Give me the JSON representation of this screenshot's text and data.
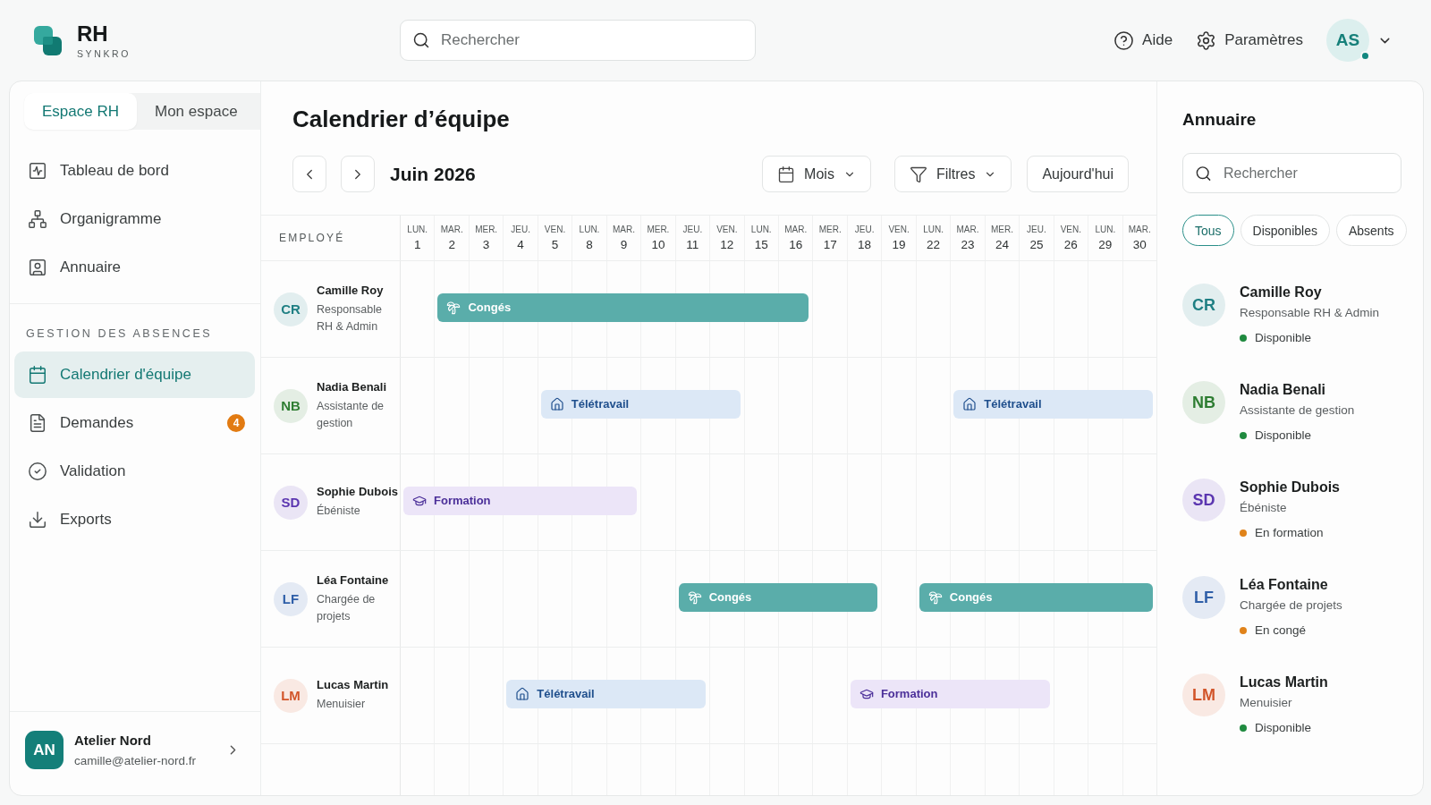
{
  "header": {
    "logo": {
      "title": "RH",
      "subtitle": "SYNKRO"
    },
    "search": {
      "placeholder": "Rechercher"
    },
    "links": [
      {
        "kind": "help",
        "label": "Aide"
      },
      {
        "kind": "settings",
        "label": "Paramètres"
      }
    ],
    "user": {
      "initials": "AS",
      "online": true
    }
  },
  "sidebar": {
    "tabs": [
      {
        "label": "Espace RH",
        "selected": true
      },
      {
        "label": "Mon espace",
        "selected": false
      }
    ],
    "items": [
      {
        "kind": "dashboard",
        "label": "Tableau de bord",
        "selected": false
      },
      {
        "kind": "org",
        "label": "Organigramme",
        "selected": false
      },
      {
        "kind": "directory",
        "label": "Annuaire",
        "selected": false
      }
    ],
    "section": {
      "title": "GESTION DES ABSENCES",
      "items": [
        {
          "kind": "calendar",
          "label": "Calendrier d'équipe",
          "selected": true
        },
        {
          "kind": "requests",
          "label": "Demandes",
          "selected": false,
          "badge": "4"
        },
        {
          "kind": "validation",
          "label": "Validation",
          "selected": false
        },
        {
          "kind": "exports",
          "label": "Exports",
          "selected": false
        }
      ]
    },
    "account": {
      "initials": "AN",
      "name": "Atelier Nord",
      "email": "camille@atelier-nord.fr"
    }
  },
  "calendar": {
    "title": "Calendrier d’équipe",
    "period": "Juin 2026",
    "view_button": {
      "label": "Mois"
    },
    "filter_button": {
      "label": "Filtres"
    },
    "today_button": {
      "label": "Aujourd'hui"
    },
    "employee_column": "EMPLOYÉ",
    "days": [
      {
        "weekday": "LUN.",
        "number": "1"
      },
      {
        "weekday": "MAR.",
        "number": "2"
      },
      {
        "weekday": "MER.",
        "number": "3"
      },
      {
        "weekday": "JEU.",
        "number": "4"
      },
      {
        "weekday": "VEN.",
        "number": "5"
      },
      {
        "weekday": "LUN.",
        "number": "8"
      },
      {
        "weekday": "MAR.",
        "number": "9"
      },
      {
        "weekday": "MER.",
        "number": "10"
      },
      {
        "weekday": "JEU.",
        "number": "11"
      },
      {
        "weekday": "VEN.",
        "number": "12"
      },
      {
        "weekday": "LUN.",
        "number": "15"
      },
      {
        "weekday": "MAR.",
        "number": "16"
      },
      {
        "weekday": "MER.",
        "number": "17"
      },
      {
        "weekday": "JEU.",
        "number": "18"
      },
      {
        "weekday": "VEN.",
        "number": "19"
      },
      {
        "weekday": "LUN.",
        "number": "22"
      },
      {
        "weekday": "MAR.",
        "number": "23"
      },
      {
        "weekday": "MER.",
        "number": "24"
      },
      {
        "weekday": "JEU.",
        "number": "25"
      },
      {
        "weekday": "VEN.",
        "number": "26"
      },
      {
        "weekday": "LUN.",
        "number": "29"
      },
      {
        "weekday": "MAR.",
        "number": "30"
      }
    ],
    "rows": [
      {
        "initials": "CR",
        "name": "Camille Roy",
        "role": "Responsable RH & Admin",
        "color": "#1f7f83",
        "timeline": [
          {
            "kind": "free"
          },
          {
            "kind": "conges",
            "label": "Congés"
          },
          {
            "kind": "conges"
          },
          {
            "kind": "conges"
          },
          {
            "kind": "conges"
          },
          {
            "kind": "conges"
          },
          {
            "kind": "conges"
          },
          {
            "kind": "conges"
          },
          {
            "kind": "conges"
          },
          {
            "kind": "conges"
          },
          {
            "kind": "conges"
          },
          {
            "kind": "conges"
          },
          {
            "kind": "free"
          },
          {
            "kind": "free"
          },
          {
            "kind": "free"
          },
          {
            "kind": "free"
          },
          {
            "kind": "free"
          },
          {
            "kind": "free"
          },
          {
            "kind": "free"
          },
          {
            "kind": "free"
          },
          {
            "kind": "free"
          },
          {
            "kind": "free"
          }
        ]
      },
      {
        "initials": "NB",
        "name": "Nadia Benali",
        "role": "Assistante de gestion",
        "color": "#2e7d32",
        "timeline": [
          {
            "kind": "free"
          },
          {
            "kind": "free"
          },
          {
            "kind": "free"
          },
          {
            "kind": "free"
          },
          {
            "kind": "teletravail",
            "label": "Télétravail"
          },
          {
            "kind": "teletravail"
          },
          {
            "kind": "teletravail"
          },
          {
            "kind": "teletravail"
          },
          {
            "kind": "teletravail"
          },
          {
            "kind": "teletravail"
          },
          {
            "kind": "free"
          },
          {
            "kind": "free"
          },
          {
            "kind": "free"
          },
          {
            "kind": "free"
          },
          {
            "kind": "free"
          },
          {
            "kind": "free"
          },
          {
            "kind": "teletravail",
            "label": "Télétravail"
          },
          {
            "kind": "teletravail"
          },
          {
            "kind": "teletravail"
          },
          {
            "kind": "teletravail"
          },
          {
            "kind": "teletravail"
          },
          {
            "kind": "teletravail"
          }
        ]
      },
      {
        "initials": "SD",
        "name": "Sophie Dubois",
        "role": "Ébéniste",
        "color": "#5b36b0",
        "timeline": [
          {
            "kind": "formation",
            "label": "Formation"
          },
          {
            "kind": "formation"
          },
          {
            "kind": "formation"
          },
          {
            "kind": "formation"
          },
          {
            "kind": "formation"
          },
          {
            "kind": "formation"
          },
          {
            "kind": "formation"
          },
          {
            "kind": "free"
          },
          {
            "kind": "free"
          },
          {
            "kind": "free"
          },
          {
            "kind": "free"
          },
          {
            "kind": "free"
          },
          {
            "kind": "free"
          },
          {
            "kind": "free"
          },
          {
            "kind": "free"
          },
          {
            "kind": "free"
          },
          {
            "kind": "free"
          },
          {
            "kind": "free"
          },
          {
            "kind": "free"
          },
          {
            "kind": "free"
          },
          {
            "kind": "free"
          },
          {
            "kind": "free"
          }
        ]
      },
      {
        "initials": "LF",
        "name": "Léa Fontaine",
        "role": "Chargée de projets",
        "color": "#2f5fa8",
        "timeline": [
          {
            "kind": "free"
          },
          {
            "kind": "free"
          },
          {
            "kind": "free"
          },
          {
            "kind": "free"
          },
          {
            "kind": "free"
          },
          {
            "kind": "free"
          },
          {
            "kind": "free"
          },
          {
            "kind": "free"
          },
          {
            "kind": "conges",
            "label": "Congés"
          },
          {
            "kind": "conges"
          },
          {
            "kind": "conges"
          },
          {
            "kind": "conges"
          },
          {
            "kind": "conges"
          },
          {
            "kind": "conges"
          },
          {
            "kind": "free"
          },
          {
            "kind": "conges",
            "label": "Congés"
          },
          {
            "kind": "conges"
          },
          {
            "kind": "conges"
          },
          {
            "kind": "conges"
          },
          {
            "kind": "conges"
          },
          {
            "kind": "conges"
          },
          {
            "kind": "conges"
          }
        ]
      },
      {
        "initials": "LM",
        "name": "Lucas Martin",
        "role": "Menuisier",
        "color": "#d2552a",
        "timeline": [
          {
            "kind": "free"
          },
          {
            "kind": "free"
          },
          {
            "kind": "free"
          },
          {
            "kind": "teletravail",
            "label": "Télétravail"
          },
          {
            "kind": "teletravail"
          },
          {
            "kind": "teletravail"
          },
          {
            "kind": "teletravail"
          },
          {
            "kind": "teletravail"
          },
          {
            "kind": "teletravail"
          },
          {
            "kind": "free"
          },
          {
            "kind": "free"
          },
          {
            "kind": "free"
          },
          {
            "kind": "free"
          },
          {
            "kind": "formation",
            "label": "Formation"
          },
          {
            "kind": "formation"
          },
          {
            "kind": "formation"
          },
          {
            "kind": "formation"
          },
          {
            "kind": "formation"
          },
          {
            "kind": "formation"
          },
          {
            "kind": "free"
          },
          {
            "kind": "free"
          },
          {
            "kind": "free"
          }
        ]
      }
    ]
  },
  "directory": {
    "title": "Annuaire",
    "search": {
      "placeholder": "Rechercher"
    },
    "filters": [
      {
        "label": "Tous",
        "selected": true
      },
      {
        "label": "Disponibles",
        "selected": false
      },
      {
        "label": "Absents",
        "selected": false
      }
    ],
    "people": [
      {
        "initials": "CR",
        "name": "Camille Roy",
        "role": "Responsable RH & Admin",
        "color": "#1f7f83",
        "status": {
          "label": "Disponible",
          "color": "#1f8a3f"
        }
      },
      {
        "initials": "NB",
        "name": "Nadia Benali",
        "role": "Assistante de gestion",
        "color": "#2e7d32",
        "status": {
          "label": "Disponible",
          "color": "#1f8a3f"
        }
      },
      {
        "initials": "SD",
        "name": "Sophie Dubois",
        "role": "Ébéniste",
        "color": "#5b36b0",
        "status": {
          "label": "En formation",
          "color": "#e0831a"
        }
      },
      {
        "initials": "LF",
        "name": "Léa Fontaine",
        "role": "Chargée de projets",
        "color": "#2f5fa8",
        "status": {
          "label": "En congé",
          "color": "#e0831a"
        }
      },
      {
        "initials": "LM",
        "name": "Lucas Martin",
        "role": "Menuisier",
        "color": "#d2552a",
        "status": {
          "label": "Disponible",
          "color": "#1f8a3f"
        }
      }
    ]
  }
}
